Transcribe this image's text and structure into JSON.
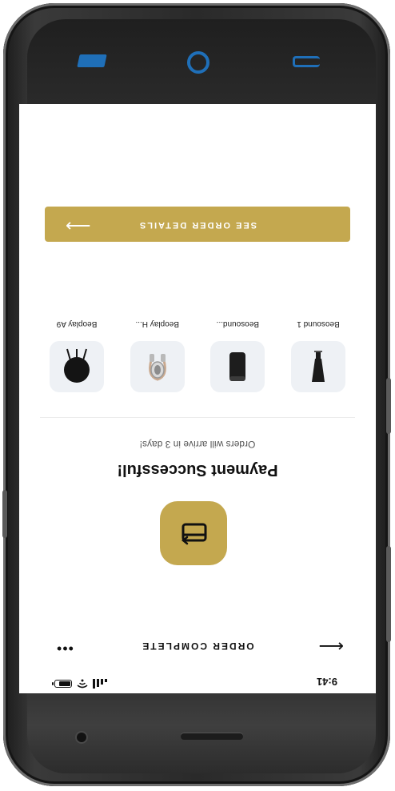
{
  "status_bar": {
    "time": "9:41"
  },
  "header": {
    "title": "ORDER COMPLETE",
    "back_icon": "arrow-left-icon",
    "more_icon": "more-dots-icon"
  },
  "success": {
    "icon": "card-icon",
    "title": "Payment Successful!",
    "subtitle": "Orders will arrive in 3 days!"
  },
  "products": [
    {
      "name": "Beosound 1",
      "icon": "speaker-cone-icon"
    },
    {
      "name": "Beosound...",
      "icon": "speaker-cylinder-icon"
    },
    {
      "name": "Beoplay H...",
      "icon": "headphones-icon"
    },
    {
      "name": "Beoplay A9",
      "icon": "round-speaker-icon"
    }
  ],
  "cta": {
    "label": "SEE ORDER DETAILS",
    "arrow_icon": "arrow-right-icon"
  },
  "colors": {
    "accent": "#c4a84f",
    "thumb_bg": "#eef1f5",
    "nav_blue": "#1f6fb8"
  }
}
